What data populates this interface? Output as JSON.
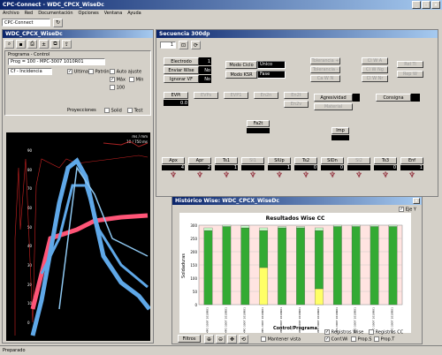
{
  "app": {
    "title": "CPC-Connect - WDC_CPCX_WiseDc",
    "menu": [
      "Archivo",
      "Red",
      "Documentación",
      "Opciones",
      "Ventana",
      "Ayuda"
    ],
    "toolbar_label": "CPC-Connect",
    "status": "Preparado"
  },
  "left": {
    "title": "WDC_CPCX_WiseDc",
    "program_group": "Programa - Control",
    "prog_text": "Prog = 100 - MPC-3007 1010R01",
    "dropdown": "Cf - Incidencia",
    "cb_ultima": "Ultima",
    "cb_patron": "Patrón",
    "opts": [
      "Máx",
      "Mín",
      "100"
    ],
    "auto": "Auto ajuste",
    "proy": "Proyecciones",
    "solid": "Solid",
    "test": "Test",
    "scope_top": "ms / mm",
    "scope_sub": "10 / 750 ms",
    "yticks": [
      "90",
      "80",
      "70",
      "60",
      "50",
      "40",
      "30",
      "20",
      "10",
      "0"
    ]
  },
  "sec": {
    "title": "Secuencia 300dp",
    "page": "1",
    "btn_electrodo": "Electrodo",
    "electrodo_val": "1",
    "btn_enviar": "Enviar Wise",
    "enviar_val": "No",
    "btn_ignorar": "Ignorar VF",
    "ignorar_val": "No",
    "modo_ciclo": "Modo Ciclo",
    "modo_ciclo_val": "Único",
    "modo_ksr": "Modo KSR",
    "modo_ksr_val": "Fase",
    "tol": [
      "Tolerancia +",
      "Tolerancia -"
    ],
    "cw": [
      "Cl W A",
      "Cl W Ng",
      "Ca W N",
      "Cl W Nr"
    ],
    "rel": [
      "Rel Ti",
      "Rep W"
    ],
    "evpi": "EVPi",
    "evpi_val": "0.0",
    "grid_labels": [
      "EVPs",
      "EVP1",
      "En2n",
      "En2t",
      "En2v"
    ],
    "agresividad": "Agresividad",
    "consigna": "Consigna",
    "material": "Material",
    "fa2t": "Fa2t",
    "imp": "Imp",
    "steps": [
      "Apx",
      "Apr",
      "Ts1",
      "SI1",
      "SIUp",
      "Ts2",
      "SIDn",
      "SI2",
      "Ts3",
      "Enf"
    ],
    "step_vals": [
      "4",
      "2",
      "1",
      "",
      "1",
      "0",
      "0",
      "",
      "0",
      "1"
    ]
  },
  "hist": {
    "title": "Histórico Wise: WDC_CPCX_WiseDc",
    "cb_eje": "Eje Y",
    "filtros": "Filtros",
    "mantener": "Mantener vista",
    "opts": [
      "Registros Wise",
      "Registros CC",
      "Conf.Wi",
      "Prop.S",
      "Prop.T"
    ]
  },
  "chart_data": {
    "type": "bar",
    "title": "Resultados Wise CC",
    "xlabel": "Control/Programa",
    "ylabel": "Soldaduras",
    "ylim": [
      0,
      300
    ],
    "yticks": [
      0,
      50,
      100,
      150,
      200,
      250,
      300
    ],
    "categories": [
      "MPC-3007 1010R01",
      "MPC-3007 1010R01",
      "MPC-3007 1010R01",
      "MPC-3007 1010R01",
      "MPC-3007 1010R01",
      "MPC-3007 1010R01",
      "MPC-3007 1010R01",
      "MPC-3007 1010R01",
      "MPC-3007 1010R01",
      "MPC-3007 1010R01",
      "MPC-3007 1010R01"
    ],
    "series": [
      {
        "values": [
          0,
          0,
          0,
          140,
          0,
          0,
          60,
          0,
          0,
          0,
          0
        ],
        "color": "#ffff66"
      },
      {
        "values": [
          280,
          295,
          290,
          140,
          290,
          290,
          220,
          295,
          295,
          295,
          295
        ],
        "color": "#33aa33"
      },
      {
        "values": [
          10,
          5,
          8,
          10,
          5,
          5,
          10,
          5,
          5,
          5,
          5
        ],
        "color": "#ccffcc"
      }
    ]
  },
  "colors": {
    "accent": "#0a246a",
    "panel": "#d4d0c8",
    "chart_bg": "#ffe4e1"
  }
}
